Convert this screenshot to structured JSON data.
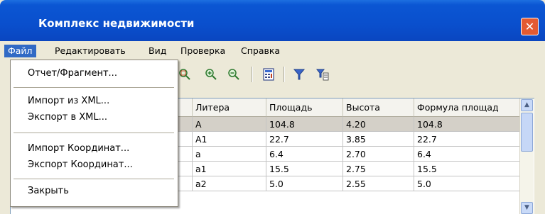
{
  "window": {
    "title": "Комплекс недвижимости",
    "close_glyph": "✕"
  },
  "menubar": [
    "Файл",
    "Редактировать",
    "Вид",
    "Проверка",
    "Справка"
  ],
  "file_menu": {
    "items": [
      "Отчет/Фрагмент...",
      "Импорт из XML...",
      "Экспорт в XML...",
      "Импорт Координат...",
      "Экспорт Координат...",
      "Закрыть"
    ]
  },
  "toolbar": {
    "icons": [
      "zoom-extent-icon",
      "zoom-in-icon",
      "zoom-out-icon",
      "calculator-icon",
      "filter-icon",
      "filter-settings-icon"
    ]
  },
  "table": {
    "columns": [
      "Литера",
      "Площадь",
      "Высота",
      "Формула площад"
    ],
    "rows": [
      [
        "A",
        "104.8",
        "4.20",
        "104.8"
      ],
      [
        "A1",
        "22.7",
        "3.85",
        "22.7"
      ],
      [
        "a",
        "6.4",
        "2.70",
        "6.4"
      ],
      [
        "a1",
        "15.5",
        "2.75",
        "15.5"
      ],
      [
        "a2",
        "5.0",
        "2.55",
        "5.0"
      ]
    ],
    "selected_row": 0
  },
  "colors": {
    "title_blue": "#0a4fcd",
    "menu_highlight": "#316ac5",
    "close_red": "#e35a32",
    "selected_row": "#d4d0c8"
  }
}
